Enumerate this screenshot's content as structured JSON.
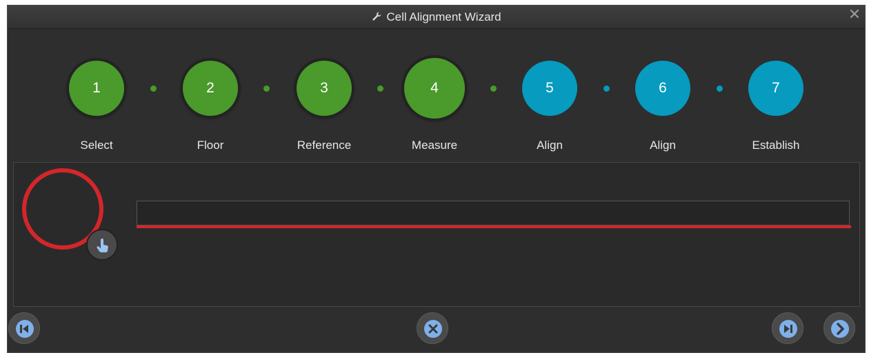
{
  "window": {
    "title": "Cell Alignment Wizard",
    "title_icon": "wrench-icon",
    "close_glyph": "✕"
  },
  "steps": [
    {
      "number": "1",
      "label": "Select",
      "state": "complete"
    },
    {
      "number": "2",
      "label": "Floor",
      "state": "complete"
    },
    {
      "number": "3",
      "label": "Reference",
      "state": "complete"
    },
    {
      "number": "4",
      "label": "Measure",
      "state": "current"
    },
    {
      "number": "5",
      "label": "Align",
      "state": "pending"
    },
    {
      "number": "6",
      "label": "Align",
      "state": "pending"
    },
    {
      "number": "7",
      "label": "Establish",
      "state": "pending"
    }
  ],
  "colors": {
    "complete": "#4a9a2c",
    "pending": "#069bbf",
    "error": "#d4262a",
    "button_accent": "#7fb0ea"
  },
  "panel": {
    "status_icon": "touch-hand-icon",
    "progress_value": 0,
    "progress_text": ""
  },
  "footer": {
    "first_button_icon": "skip-to-start-icon",
    "cancel_button_icon": "cancel-icon",
    "skip_button_icon": "play-pause-icon",
    "next_button_icon": "chevron-right-icon"
  }
}
